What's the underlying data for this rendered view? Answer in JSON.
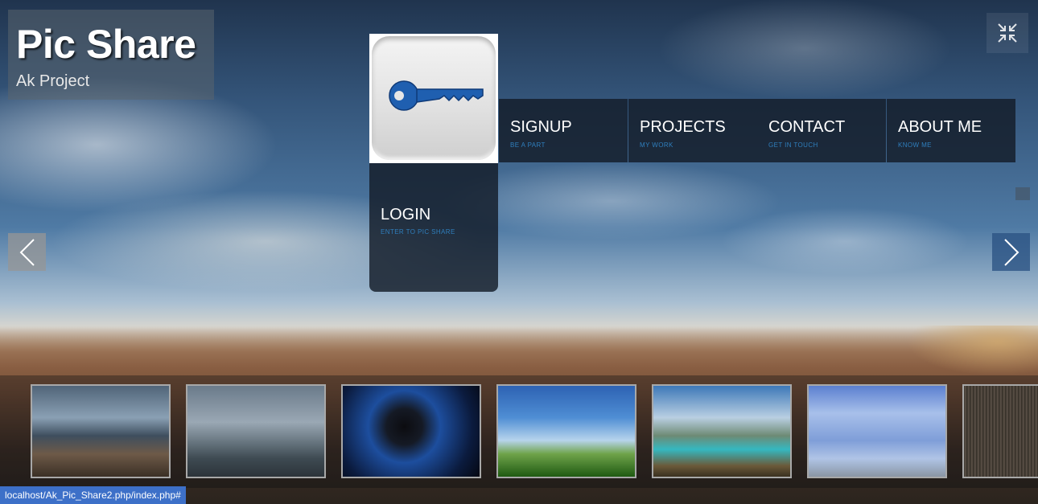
{
  "logo": {
    "title": "Pic Share",
    "subtitle": "Ak Project"
  },
  "menu": {
    "signup": {
      "label": "SIGNUP",
      "sub": "BE A PART"
    },
    "projects": {
      "label": "PROJECTS",
      "sub": "MY WORK"
    },
    "contact": {
      "label": "CONTACT",
      "sub": "GET IN TOUCH"
    },
    "about": {
      "label": "ABOUT ME",
      "sub": "KNOW ME"
    },
    "login": {
      "label": "LOGIN",
      "sub": "ENTER TO PIC SHARE"
    }
  },
  "icons": {
    "fullscreen": "fullscreen-exit-icon",
    "key": "key-icon",
    "prev": "chevron-left-icon",
    "next": "chevron-right-icon"
  },
  "colors": {
    "accent": "#2f7fbd",
    "tile_bg": "#141c28",
    "key_blue": "#1f5fb0",
    "status_bar": "#3d70c8"
  },
  "thumbnails": [
    "canyon-sky",
    "misty-cliffs",
    "space-planet",
    "grass-sky",
    "coastal-lake",
    "blue-clouds",
    "portrait"
  ],
  "status": {
    "url": "localhost/Ak_Pic_Share2.php/index.php#"
  }
}
